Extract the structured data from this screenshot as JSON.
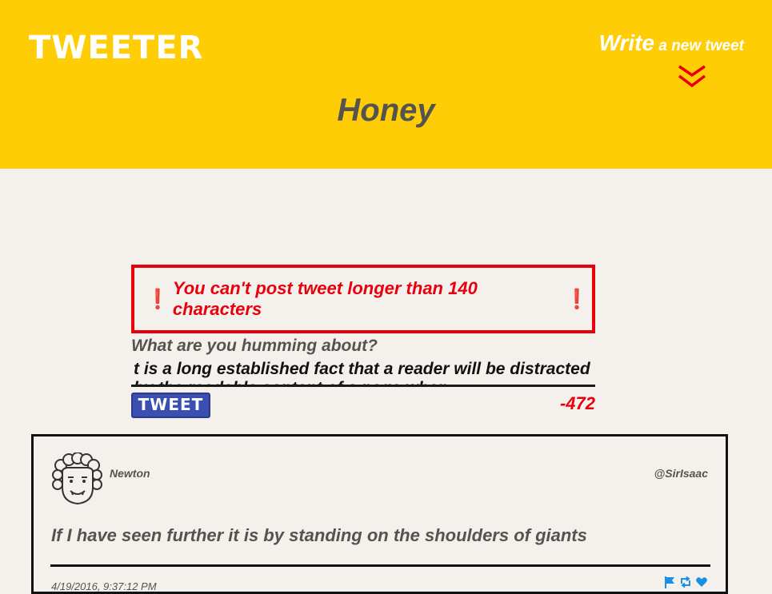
{
  "header": {
    "brand": "TWEETER",
    "write_big": "Write",
    "write_small": " a new tweet",
    "page_title": "Honey"
  },
  "composer": {
    "error_message": "You can't post tweet longer than 140 characters",
    "prompt": "What are you humming about?",
    "input_value": "t is a long established fact that a reader will be distracted by the readable content of a page when",
    "button_label": "TWEET",
    "counter": "-472"
  },
  "tweets": [
    {
      "name": "Newton",
      "handle": "@SirIsaac",
      "text": "If I have seen further it is by standing on the shoulders of giants",
      "timestamp": "4/19/2016, 9:37:12 PM"
    }
  ],
  "colors": {
    "header_bg": "#ffcd05",
    "error": "#e8000d",
    "button_bg": "#3b4fb0",
    "icon_blue": "#1a8fe6"
  },
  "icons": [
    "chevron-down-icon",
    "avatar-icon",
    "flag-icon",
    "retweet-icon",
    "heart-icon"
  ]
}
